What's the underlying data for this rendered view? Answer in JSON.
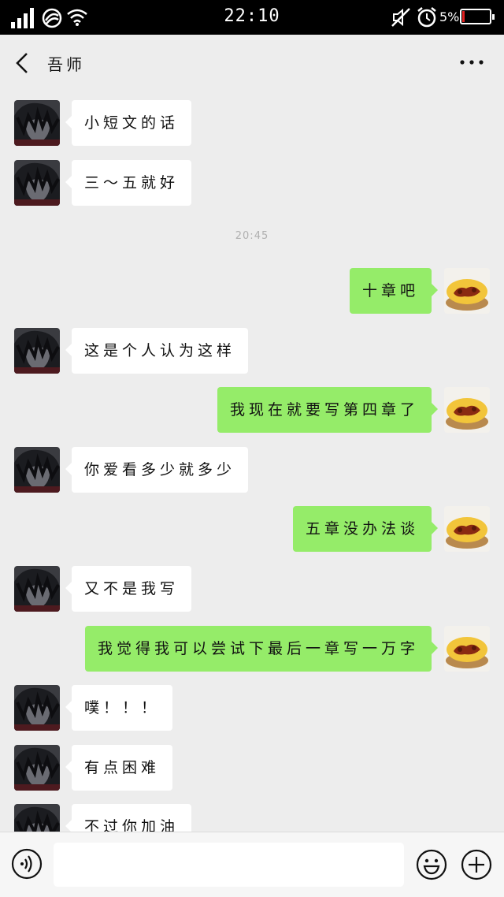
{
  "status_bar": {
    "time": "22:10",
    "battery_percent": "5%",
    "battery_level": 0.05
  },
  "header": {
    "title": "吾师"
  },
  "timestamp": "20:45",
  "messages": [
    {
      "from": "other",
      "text": "小短文的话"
    },
    {
      "from": "other",
      "text": "三～五就好"
    },
    {
      "from": "me",
      "text": "十章吧"
    },
    {
      "from": "other",
      "text": "这是个人认为这样"
    },
    {
      "from": "me",
      "text": "我现在就要写第四章了"
    },
    {
      "from": "other",
      "text": "你爱看多少就多少"
    },
    {
      "from": "me",
      "text": "五章没办法谈"
    },
    {
      "from": "other",
      "text": "又不是我写"
    },
    {
      "from": "me",
      "text": "我觉得我可以尝试下最后一章写一万字"
    },
    {
      "from": "other",
      "text": "噗！！！"
    },
    {
      "from": "other",
      "text": "有点困难"
    },
    {
      "from": "other",
      "text": "不过你加油"
    }
  ],
  "input": {
    "value": ""
  },
  "colors": {
    "sent_bubble": "#95ec69",
    "received_bubble": "#ffffff",
    "background": "#ededed"
  }
}
